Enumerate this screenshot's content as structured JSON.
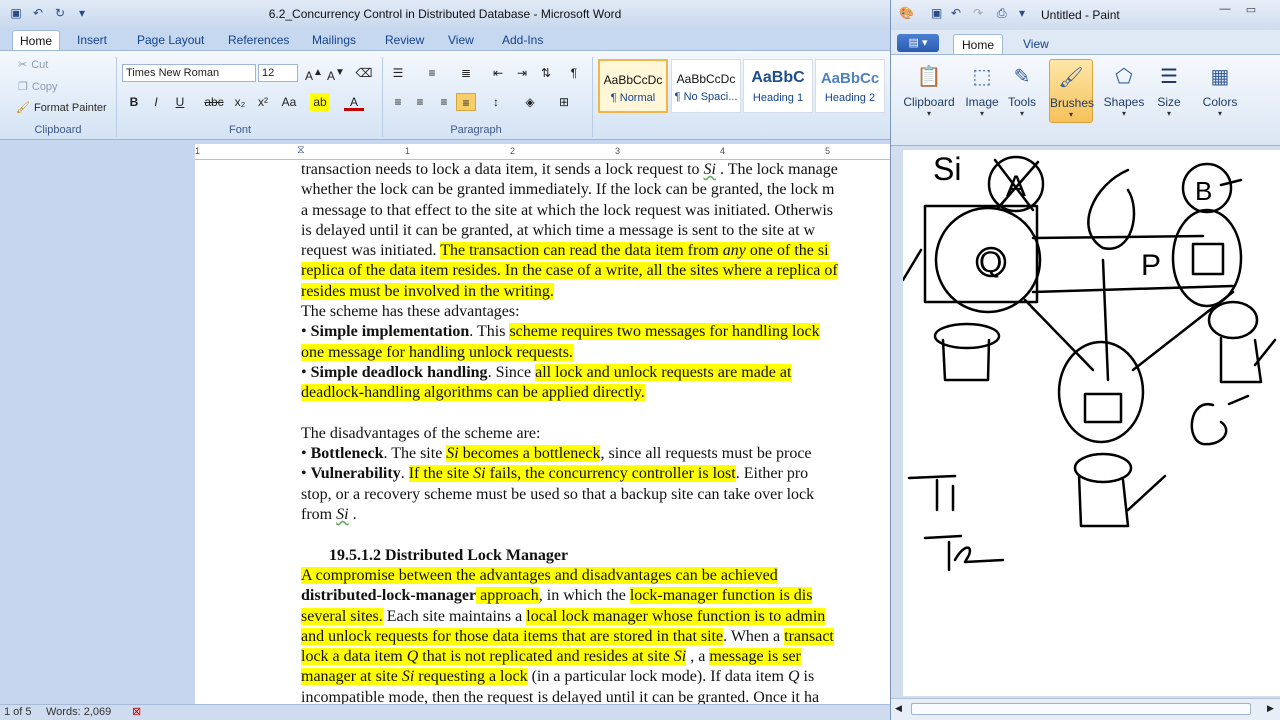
{
  "word": {
    "title": "6.2_Concurrency Control in Distributed Database - Microsoft Word",
    "tabs": [
      "Home",
      "Insert",
      "Page Layout",
      "References",
      "Mailings",
      "Review",
      "View",
      "Add-Ins"
    ],
    "clipboard": {
      "cut": "Cut",
      "copy": "Copy",
      "format_painter": "Format Painter",
      "group": "Clipboard"
    },
    "font": {
      "name": "Times New Roman",
      "size": "12",
      "group": "Font"
    },
    "paragraph": {
      "group": "Paragraph"
    },
    "styles": [
      {
        "sample": "AaBbCcDc",
        "name": "¶ Normal"
      },
      {
        "sample": "AaBbCcDc",
        "name": "¶ No Spaci..."
      },
      {
        "sample": "AaBbC",
        "name": "Heading 1"
      },
      {
        "sample": "AaBbCc",
        "name": "Heading 2"
      }
    ],
    "ruler": [
      "1",
      "1",
      "2",
      "3",
      "4",
      "5"
    ],
    "status": {
      "page": "1 of 5",
      "words": "Words: 2,069"
    },
    "doc": {
      "l1": "transaction needs to lock a data item, it sends a lock request to ",
      "l1_si": "Si",
      "l1_end": " . The lock manage",
      "l2": "whether the lock can be granted immediately. If the lock can be granted, the lock m",
      "l3": "a message to that effect to the site at which the lock request was initiated. Otherwis",
      "l4": "is delayed until it can be granted, at which time a message is sent to the site at w",
      "l5a": "request was initiated. ",
      "l5b": "The transaction can read the data item from ",
      "l5c": "any",
      "l5d": " one of the si",
      "l6a": "replica of the data item resides.",
      "l6b": " In the case of a write, all the sites where a replica of",
      "l7": "resides must be involved in the writing.",
      "l8": "The scheme has these advantages:",
      "l9a": "• ",
      "l9b": "Simple implementation",
      "l9c": ". This ",
      "l9d": "scheme requires two messages for handling lock",
      "l10": "one message for handling unlock requests.",
      "l11a": "• ",
      "l11b": "Simple deadlock handling",
      "l11c": ". Since ",
      "l11d": "all lock and unlock requests are made at",
      "l12": "deadlock-handling algorithms can be applied directly.",
      "l13": "The disadvantages of the scheme are:",
      "l14a": "• ",
      "l14b": "Bottleneck",
      "l14c": ". The site ",
      "l14d": "Si",
      "l14e": " becomes a bottleneck",
      "l14f": ", since all requests must be proce",
      "l15a": "• ",
      "l15b": "Vulnerability",
      "l15c": ". ",
      "l15d": "If the site ",
      "l15e": "Si",
      "l15f": " fails, the concurrency controller is lost",
      "l15g": ". Either pro",
      "l16": "stop, or a recovery scheme must be used so that a backup site can take over lock",
      "l17a": "from ",
      "l17b": "Si",
      "l17c": " .",
      "heading": "19.5.1.2 Distributed Lock Manager",
      "l18": "A compromise between the advantages and disadvantages can be achieved",
      "l19a": "distributed-lock-manager",
      "l19b": " approach",
      "l19c": ", in which the ",
      "l19d": "lock-manager function is dis",
      "l20a": "several sites.",
      "l20b": " Each site maintains a ",
      "l20c": "local lock manager whose function is to admin",
      "l21a": "and unlock requests for those data items that are stored in that site",
      "l21b": ". When a ",
      "l21c": "transact",
      "l22a": "lock a data item ",
      "l22b": "Q",
      "l22c": " that is not replicated and resides at site ",
      "l22d": "Si",
      "l22e": " , a ",
      "l22f": "message is ser",
      "l23a": "manager at site ",
      "l23b": "Si",
      "l23c": " requesting a lock",
      "l23d": " (in a particular lock mode). If data item ",
      "l23e": "Q",
      "l23f": " is",
      "l24": "incompatible mode, then the request is delayed until it can be granted. Once it ha"
    }
  },
  "paint": {
    "title": "Untitled - Paint",
    "tabs": [
      "Home",
      "View"
    ],
    "tools": [
      {
        "label": "Clipboard",
        "icon": "clipboard-icon"
      },
      {
        "label": "Image",
        "icon": "image-icon"
      },
      {
        "label": "Tools",
        "icon": "tools-icon"
      },
      {
        "label": "Brushes",
        "icon": "brush-icon"
      },
      {
        "label": "Shapes",
        "icon": "shapes-icon"
      },
      {
        "label": "Size",
        "icon": "size-icon"
      },
      {
        "label": "Colors",
        "icon": "colors-icon"
      }
    ],
    "selected_tool": "Brushes",
    "canvas_text": {
      "si": "Si",
      "a": "A",
      "b": "B",
      "p": "P",
      "q": "Q",
      "t1": "T1",
      "t2": "T2"
    }
  }
}
